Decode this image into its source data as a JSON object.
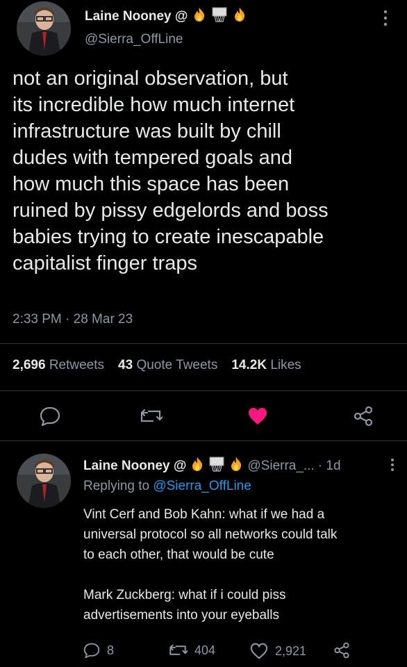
{
  "tweet": {
    "name": "Laine Nooney @",
    "handle": "@Sierra_OffLine",
    "text_lines": [
      "not an original observation, but",
      "its incredible how much internet",
      "infrastructure was built by chill",
      "dudes with tempered goals and",
      "how much this space has been",
      "ruined by pissy edgelords and boss",
      "babies trying to create inescapable",
      "capitalist finger traps"
    ],
    "timestamp": "2:33 PM · 28 Mar 23",
    "stats": {
      "retweets_num": "2,696",
      "retweets_label": "Retweets",
      "quotes_num": "43",
      "quotes_label": "Quote Tweets",
      "likes_num": "14.2K",
      "likes_label": "Likes"
    }
  },
  "reply": {
    "name": "Laine Nooney @",
    "handle": "@Sierra_...",
    "time": "· 1d",
    "replying_prefix": "Replying to ",
    "replying_handle": "@Sierra_OffLine",
    "lines": [
      "Vint Cerf and Bob Kahn: what if we had a",
      "universal protocol so all networks could talk",
      "to each other, that would be cute",
      "",
      "Mark Zuckberg: what if i could piss",
      "advertisements into your eyeballs"
    ],
    "counts": {
      "replies": "8",
      "retweets": "404",
      "likes": "2,921"
    }
  },
  "colors": {
    "background": "#000000",
    "text": "#e7e9ea",
    "muted": "#8b98a5",
    "link": "#1d9bf0",
    "like": "#f91880"
  },
  "icons": [
    "fire-icon",
    "basketball-hoop-icon",
    "more-icon",
    "reply-icon",
    "retweet-icon",
    "heart-icon",
    "share-icon"
  ]
}
